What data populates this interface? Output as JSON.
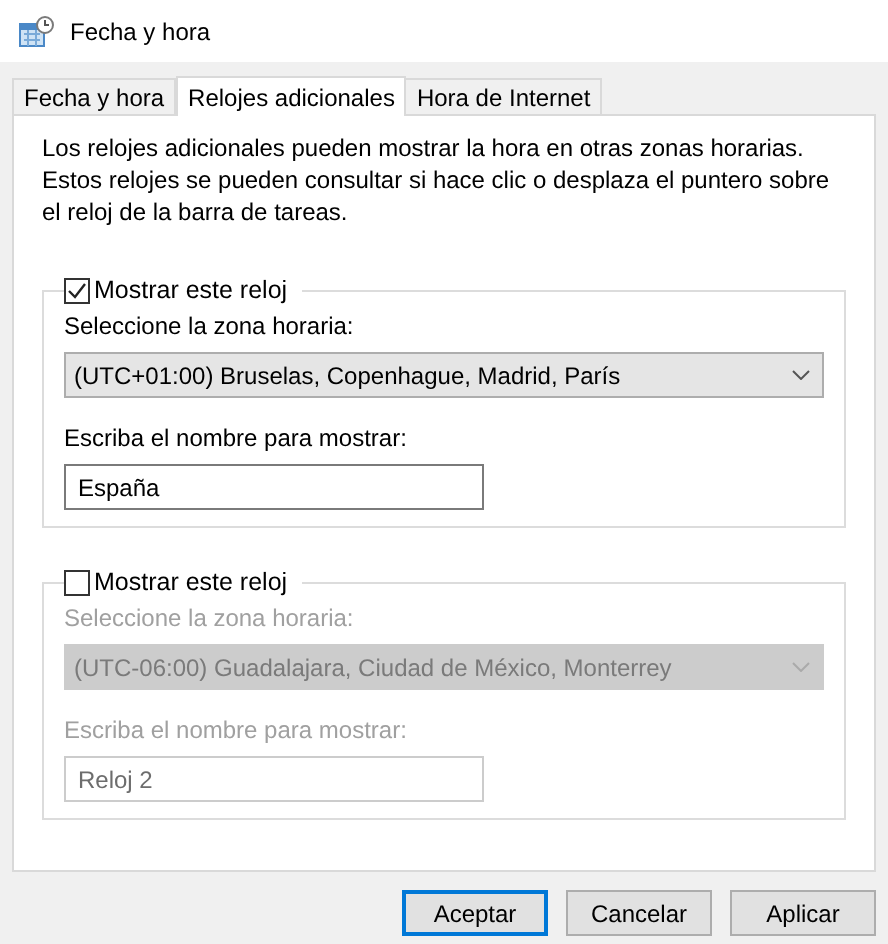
{
  "window": {
    "title": "Fecha y hora"
  },
  "tabs": [
    {
      "label": "Fecha y hora",
      "selected": false
    },
    {
      "label": "Relojes adicionales",
      "selected": true
    },
    {
      "label": "Hora de Internet",
      "selected": false
    }
  ],
  "description": "Los relojes adicionales pueden mostrar la hora en otras zonas horarias. Estos relojes se pueden consultar si hace clic o desplaza el puntero sobre el reloj de la barra de tareas.",
  "clocks": [
    {
      "label": "Mostrar este reloj",
      "checked": true,
      "zone_label": "Seleccione la zona horaria:",
      "zone": "(UTC+01:00) Bruselas, Copenhague, Madrid, París",
      "name_label": "Escriba el nombre para mostrar:",
      "name": "España"
    },
    {
      "label": "Mostrar este reloj",
      "checked": false,
      "zone_label": "Seleccione la zona horaria:",
      "zone": "(UTC-06:00) Guadalajara, Ciudad de México, Monterrey",
      "name_label": "Escriba el nombre para mostrar:",
      "name": "Reloj 2"
    }
  ],
  "buttons": [
    {
      "label": "Aceptar",
      "default": true
    },
    {
      "label": "Cancelar",
      "default": false
    },
    {
      "label": "Aplicar",
      "default": false
    }
  ]
}
